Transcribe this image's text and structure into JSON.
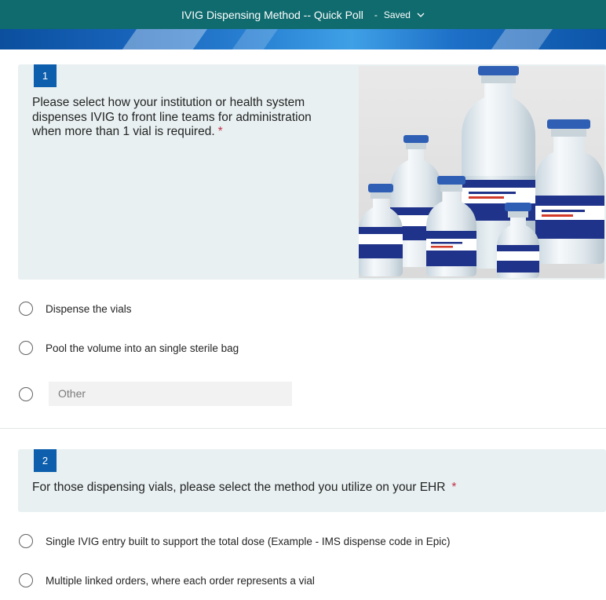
{
  "header": {
    "title": "IVIG Dispensing Method -- Quick Poll",
    "separator": "-",
    "status": "Saved",
    "background_color": "#0f6b6e",
    "dropdown_icon": "chevron-down-icon"
  },
  "questions": [
    {
      "number": "1",
      "text": "Please select how your institution or health system dispenses IVIG to front line teams for administration when more than 1 vial is required.",
      "required_marker": "*",
      "options": [
        "Dispense the vials",
        "Pool the volume into an single sterile bag"
      ],
      "other": {
        "placeholder": "Other",
        "value": ""
      }
    },
    {
      "number": "2",
      "text": "For those dispensing vials, please select the method you utilize on your EHR",
      "required_marker": "*",
      "options": [
        "Single IVIG entry built to support the total dose (Example - IMS dispense code in Epic)",
        "Multiple linked orders, where each order represents a vial"
      ]
    }
  ],
  "colors": {
    "number_badge": "#0d5fad",
    "card_background": "#e8f0f1",
    "required": "#c4314b"
  }
}
